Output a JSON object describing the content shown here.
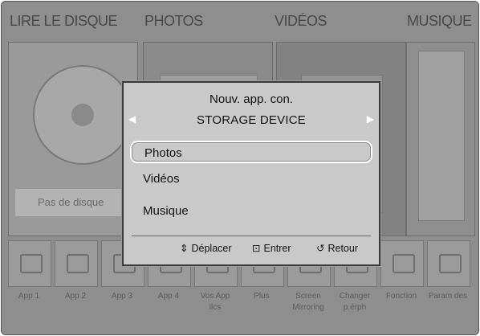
{
  "top_tabs": [
    {
      "label": "LIRE LE DISQUE"
    },
    {
      "label": "PHOTOS"
    },
    {
      "label": "VIDÉOS"
    },
    {
      "label": "MUSIQUE"
    }
  ],
  "disc_panel": {
    "no_disc_label": "Pas de disque"
  },
  "apps": [
    {
      "label": "App 1"
    },
    {
      "label": "App 2"
    },
    {
      "label": "App 3"
    },
    {
      "label": "App 4"
    },
    {
      "label": "Vos App\nllcs"
    },
    {
      "label": "Plus"
    },
    {
      "label": "Screen\nMirroring"
    },
    {
      "label": "Changer\np.érph"
    },
    {
      "label": "Fonction"
    },
    {
      "label": "Param des"
    }
  ],
  "dialog": {
    "title": "Nouv. app. con.",
    "subtitle": "STORAGE DEVICE",
    "items": [
      {
        "label": "Photos",
        "selected": true
      },
      {
        "label": "Vidéos",
        "selected": false
      },
      {
        "label": "Musique",
        "selected": false
      }
    ],
    "hints": [
      {
        "icon": "up-down-arrow-icon",
        "glyph": "⇕",
        "label": "Déplacer"
      },
      {
        "icon": "enter-icon",
        "glyph": "⊡",
        "label": "Entrer"
      },
      {
        "icon": "return-icon",
        "glyph": "↺",
        "label": "Retour"
      }
    ]
  }
}
